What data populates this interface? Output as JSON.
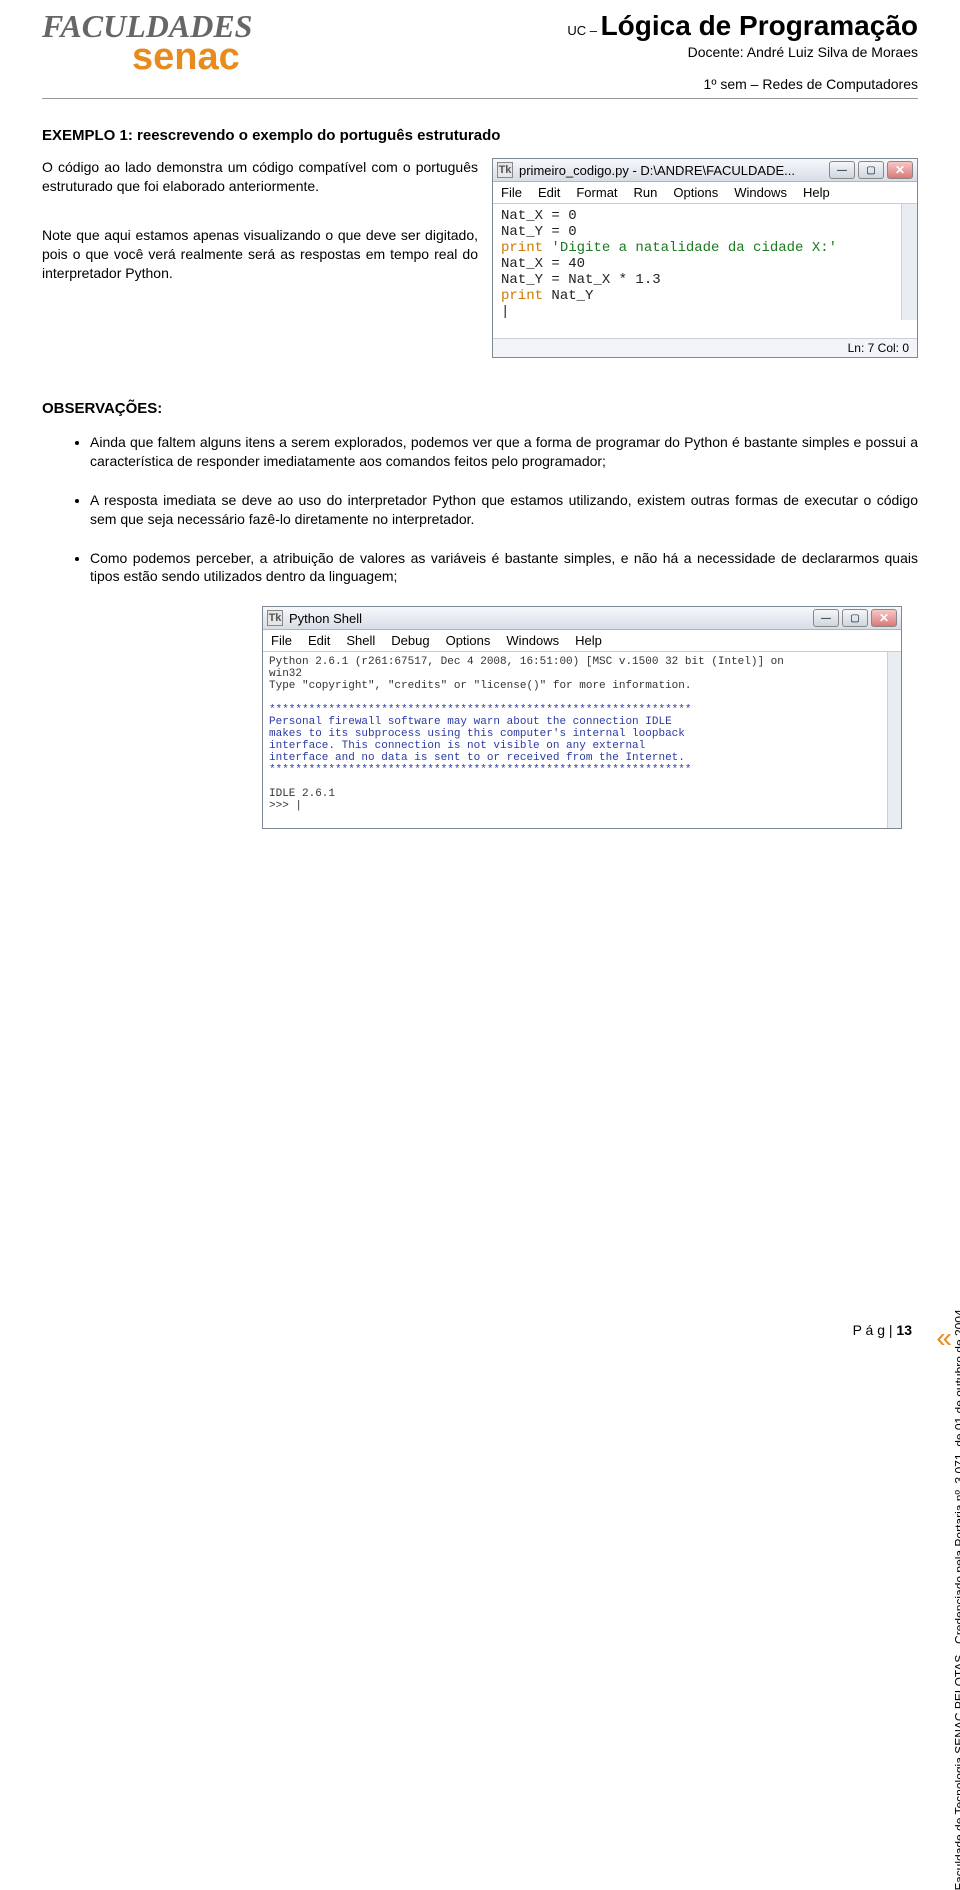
{
  "header": {
    "logo_top": "FACULDADES",
    "logo_bottom": "senac",
    "uc_prefix": "UC –",
    "uc_title": "Lógica de Programação",
    "docente": "Docente: André Luiz Silva de Moraes",
    "sem": "1º sem – Redes de Computadores"
  },
  "section_title": "EXEMPLO 1: reescrevendo o exemplo do português estruturado",
  "para1": "O código ao lado demonstra um código compatível com o português estruturado que foi elaborado anteriormente.",
  "para2": "Note que aqui estamos apenas visualizando o que deve ser digitado, pois o que você verá realmente será as respostas em tempo real do interpretador Python.",
  "ide": {
    "icon_label": "Tk",
    "title": "primeiro_codigo.py - D:\\ANDRE\\FACULDADE...",
    "menus": [
      "File",
      "Edit",
      "Format",
      "Run",
      "Options",
      "Windows",
      "Help"
    ],
    "code": [
      {
        "plain": "Nat_X = 0"
      },
      {
        "plain": "Nat_Y = 0"
      },
      {
        "kw": "print",
        "str": " 'Digite a natalidade da cidade X:'"
      },
      {
        "plain": "Nat_X = 40"
      },
      {
        "plain": "Nat_Y = Nat_X * 1.3"
      },
      {
        "kw": "print",
        "plain2": " Nat_Y"
      },
      {
        "plain": "|"
      }
    ],
    "status": "Ln: 7  Col: 0"
  },
  "obs_title": "OBSERVAÇÕES:",
  "obs": [
    "Ainda que faltem alguns itens a serem explorados, podemos ver que a forma de programar do Python é bastante simples e possui a característica de responder imediatamente aos comandos feitos pelo programador;",
    "A resposta imediata se deve ao uso do interpretador Python que estamos utilizando, existem outras formas de executar o código sem que seja necessário fazê-lo diretamente no interpretador.",
    "Como podemos perceber, a atribuição de valores as variáveis é bastante simples, e não há a necessidade de declararmos quais tipos estão sendo utilizados dentro da linguagem;"
  ],
  "shell": {
    "icon_label": "Tk",
    "title": "Python Shell",
    "menus": [
      "File",
      "Edit",
      "Shell",
      "Debug",
      "Options",
      "Windows",
      "Help"
    ],
    "line1": "Python 2.6.1 (r261:67517, Dec  4 2008, 16:51:00) [MSC v.1500 32 bit (Intel)] on",
    "line2": "win32",
    "line3": "Type \"copyright\", \"credits\" or \"license()\" for more information.",
    "stars": "    ****************************************************************",
    "w1": "    Personal firewall software may warn about the connection IDLE",
    "w2": "    makes to its subprocess using this computer's internal loopback",
    "w3": "    interface.  This connection is not visible on any external",
    "w4": "    interface and no data is sent to or received from the Internet.",
    "idle": "IDLE 2.6.1",
    "prompt": ">>> |"
  },
  "vertical": "Faculdade de Tecnologia SENAC PELOTAS - Credenciado pela Portaria nº. 3.071, de 01 de outubro de 2004.",
  "pagenum_label": "P á g | ",
  "pagenum": "13"
}
